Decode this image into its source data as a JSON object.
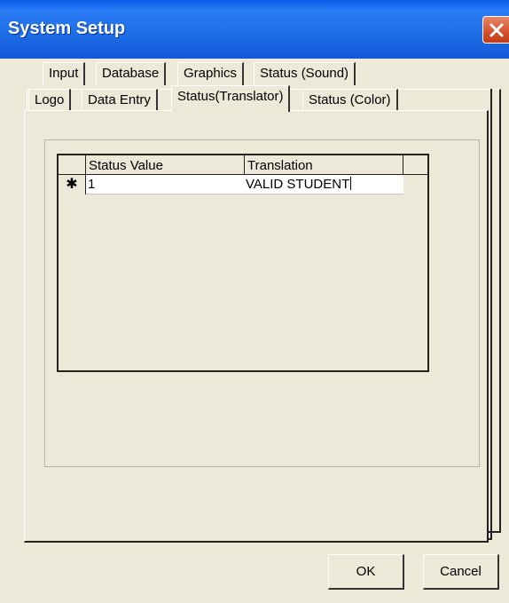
{
  "window": {
    "title": "System Setup"
  },
  "tabs": {
    "row1": [
      "Input",
      "Database",
      "Graphics",
      "Status (Sound)"
    ],
    "row2": [
      "Logo",
      "Data Entry",
      "Status(Translator)",
      "Status (Color)"
    ],
    "selected": "Status(Translator)"
  },
  "grid": {
    "columns": [
      "Status Value",
      "Translation"
    ],
    "rows": [
      {
        "selector": "✱",
        "status_value": "1",
        "translation": "VALID STUDENT"
      }
    ]
  },
  "buttons": {
    "ok": "OK",
    "cancel": "Cancel"
  }
}
